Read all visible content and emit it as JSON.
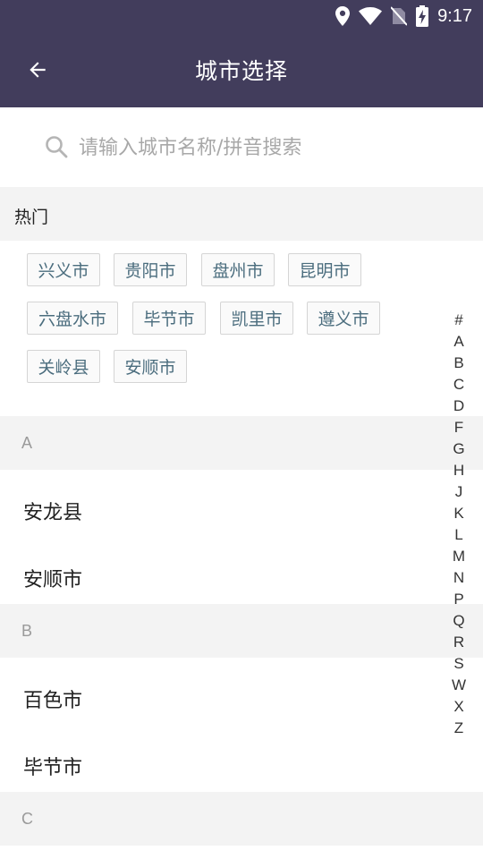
{
  "status_bar": {
    "time": "9:17",
    "icons": [
      "location-icon",
      "wifi-icon",
      "no-sim-icon",
      "battery-charging-icon"
    ]
  },
  "toolbar": {
    "title": "城市选择",
    "back_icon": "arrow-back-icon"
  },
  "search": {
    "placeholder": "请输入城市名称/拼音搜索",
    "value": "",
    "icon": "search-icon"
  },
  "hot": {
    "header": "热门",
    "cities": [
      "兴义市",
      "贵阳市",
      "盘州市",
      "昆明市",
      "六盘水市",
      "毕节市",
      "凯里市",
      "遵义市",
      "关岭县",
      "安顺市"
    ]
  },
  "sections": [
    {
      "letter": "A",
      "cities": [
        "安龙县",
        "安顺市"
      ]
    },
    {
      "letter": "B",
      "cities": [
        "百色市",
        "毕节市"
      ]
    },
    {
      "letter": "C",
      "cities": []
    }
  ],
  "index_letters": [
    "#",
    "A",
    "B",
    "C",
    "D",
    "F",
    "G",
    "H",
    "J",
    "K",
    "L",
    "M",
    "N",
    "P",
    "Q",
    "R",
    "S",
    "W",
    "X",
    "Z"
  ],
  "colors": {
    "app_bar": "#423d5c",
    "section_bg": "#f3f3f3",
    "chip_text": "#4b6d7e"
  }
}
